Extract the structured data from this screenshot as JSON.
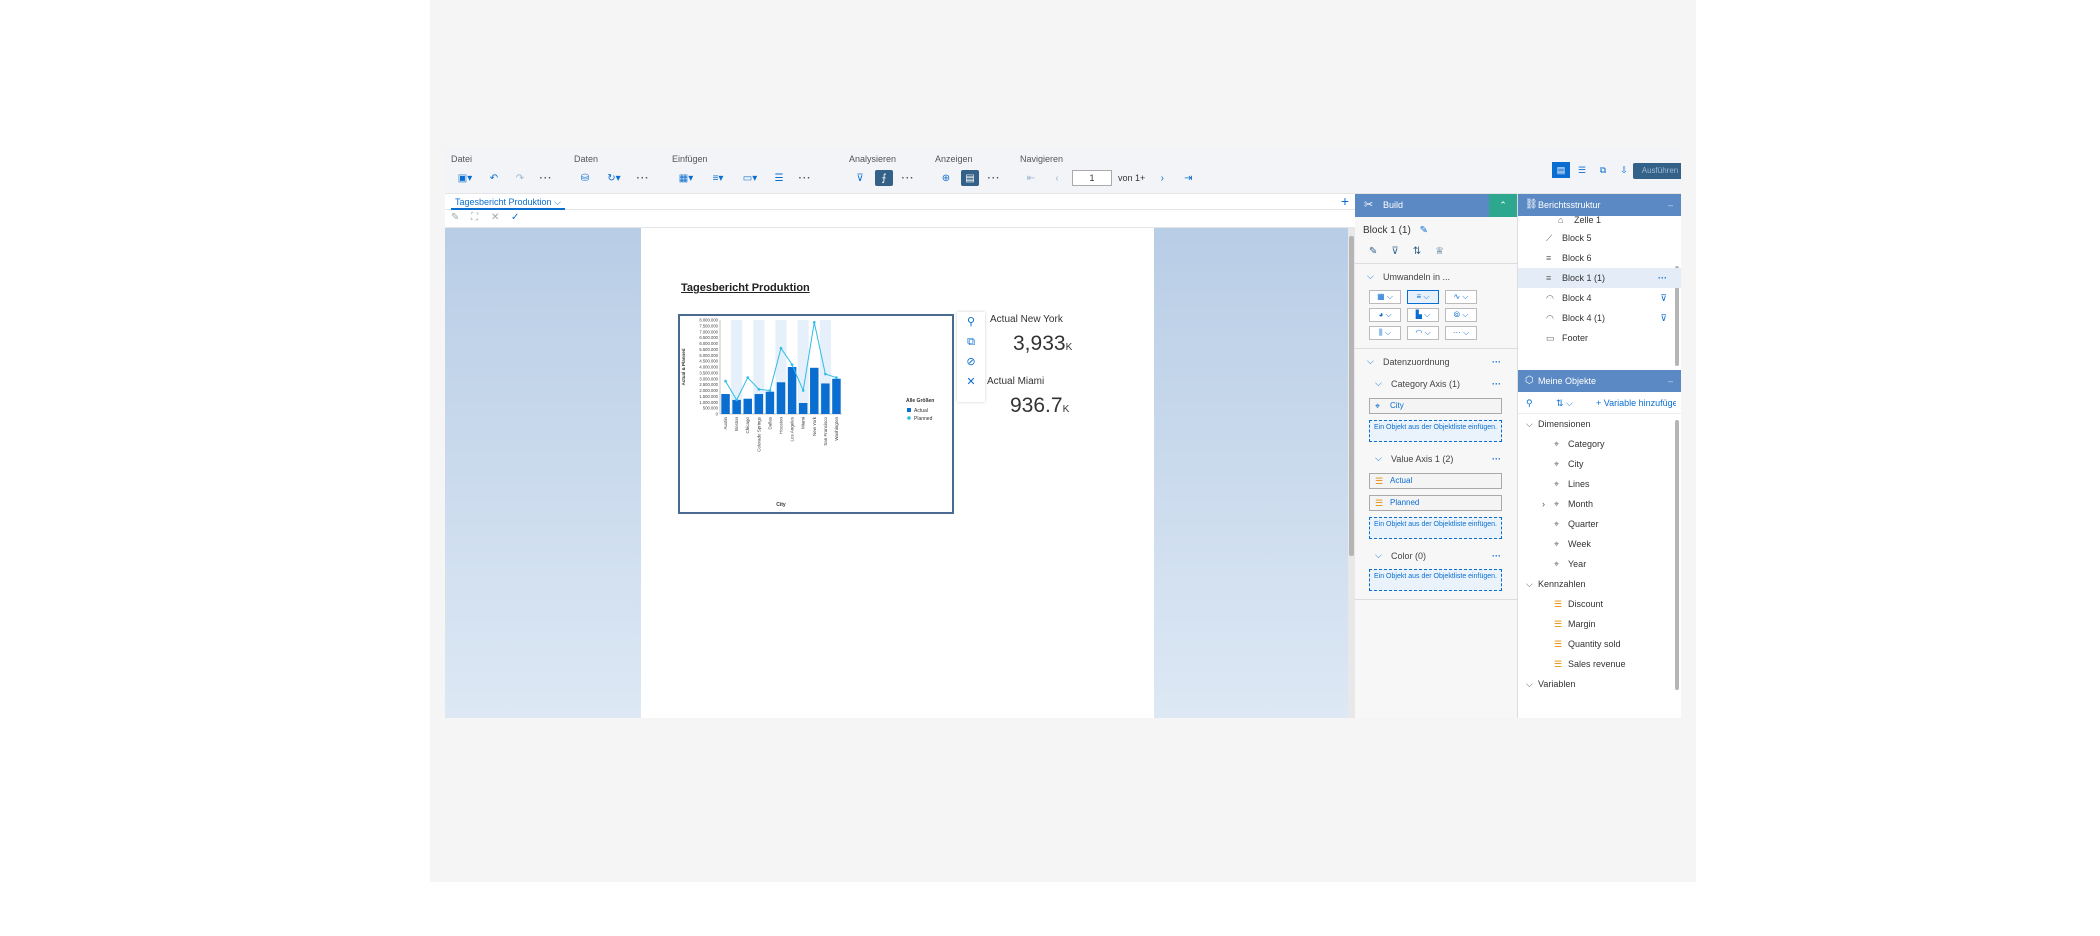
{
  "toolbar": {
    "groups": [
      {
        "label": "Datei"
      },
      {
        "label": "Daten"
      },
      {
        "label": "Einfügen"
      },
      {
        "label": "Analysieren"
      },
      {
        "label": "Anzeigen"
      },
      {
        "label": "Navigieren"
      }
    ],
    "page_value": "1",
    "page_of": "von 1+",
    "top_button_label": "Ausführen"
  },
  "tab": {
    "label": "Tagesbericht Produktion"
  },
  "report": {
    "title": "Tagesbericht Produktion",
    "kpis": [
      {
        "label": "Actual New York",
        "value": "3,933",
        "unit": "K"
      },
      {
        "label": "Actual Miami",
        "value": "936.7",
        "unit": "K"
      }
    ]
  },
  "chart_data": {
    "type": "bar",
    "categories": [
      "Austin",
      "Boston",
      "Chicago",
      "Colorado Springs",
      "Dallas",
      "Houston",
      "Los Angeles",
      "Miami",
      "New York",
      "San Francisco",
      "Washington"
    ],
    "series": [
      {
        "name": "Actual",
        "kind": "bar",
        "values": [
          1700000,
          1200000,
          1300000,
          1700000,
          1900000,
          2700000,
          4000000,
          936700,
          3933000,
          2600000,
          3000000
        ]
      },
      {
        "name": "Planned",
        "kind": "line",
        "values": [
          2800000,
          1200000,
          3100000,
          2100000,
          2000000,
          5600000,
          4200000,
          2000000,
          7800000,
          3400000,
          3100000
        ]
      }
    ],
    "ytick_labels": [
      "8.000.000",
      "7.500.000",
      "7.000.000",
      "6.500.000",
      "6.000.000",
      "5.500.000",
      "5.000.000",
      "4.500.000",
      "4.000.000",
      "3.500.000",
      "3.000.000",
      "2.500.000",
      "2.000.000",
      "1.500.000",
      "1.000.000",
      "500.000",
      "0"
    ],
    "xlabel": "City",
    "ylabel": "Actual & Planned",
    "legend_title": "Alle Größen",
    "ylim": [
      0,
      8000000
    ],
    "colors": {
      "bar": "#0a6ed1",
      "line": "#2ebce8",
      "band": "#e6f0fa"
    }
  },
  "build": {
    "header": "Build",
    "block_name": "Block 1 (1)",
    "transform_label": "Umwandeln in ...",
    "data_assignment": "Datenzuordnung",
    "category_axis": "Category Axis (1)",
    "category_field": "City",
    "value_axis": "Value Axis 1 (2)",
    "value_fields": [
      "Actual",
      "Planned"
    ],
    "color": "Color (0)",
    "drop_hint": "Ein Objekt aus der Objektliste einfügen."
  },
  "structure": {
    "header": "Berichtsstruktur",
    "items": [
      {
        "label": "Zelle 1",
        "icon": "cell-icon",
        "filter": false,
        "selected": false
      },
      {
        "label": "Block 5",
        "icon": "line-chart-icon",
        "filter": false,
        "selected": false
      },
      {
        "label": "Block 6",
        "icon": "bar-chart-icon",
        "filter": false,
        "selected": false
      },
      {
        "label": "Block 1 (1)",
        "icon": "bar-chart-icon",
        "filter": false,
        "selected": true
      },
      {
        "label": "Block 4",
        "icon": "gauge-icon",
        "filter": true,
        "selected": false
      },
      {
        "label": "Block 4 (1)",
        "icon": "gauge-icon",
        "filter": true,
        "selected": false
      },
      {
        "label": "Footer",
        "icon": "footer-icon",
        "filter": false,
        "selected": false
      }
    ]
  },
  "objects": {
    "header": "Meine Objekte",
    "add_variable": "Variable hinzufügen",
    "dimensions_label": "Dimensionen",
    "dimensions": [
      "Category",
      "City",
      "Lines",
      "Month",
      "Quarter",
      "Week",
      "Year"
    ],
    "measures_label": "Kennzahlen",
    "measures": [
      "Discount",
      "Margin",
      "Quantity sold",
      "Sales revenue"
    ],
    "variables_label": "Variablen"
  }
}
